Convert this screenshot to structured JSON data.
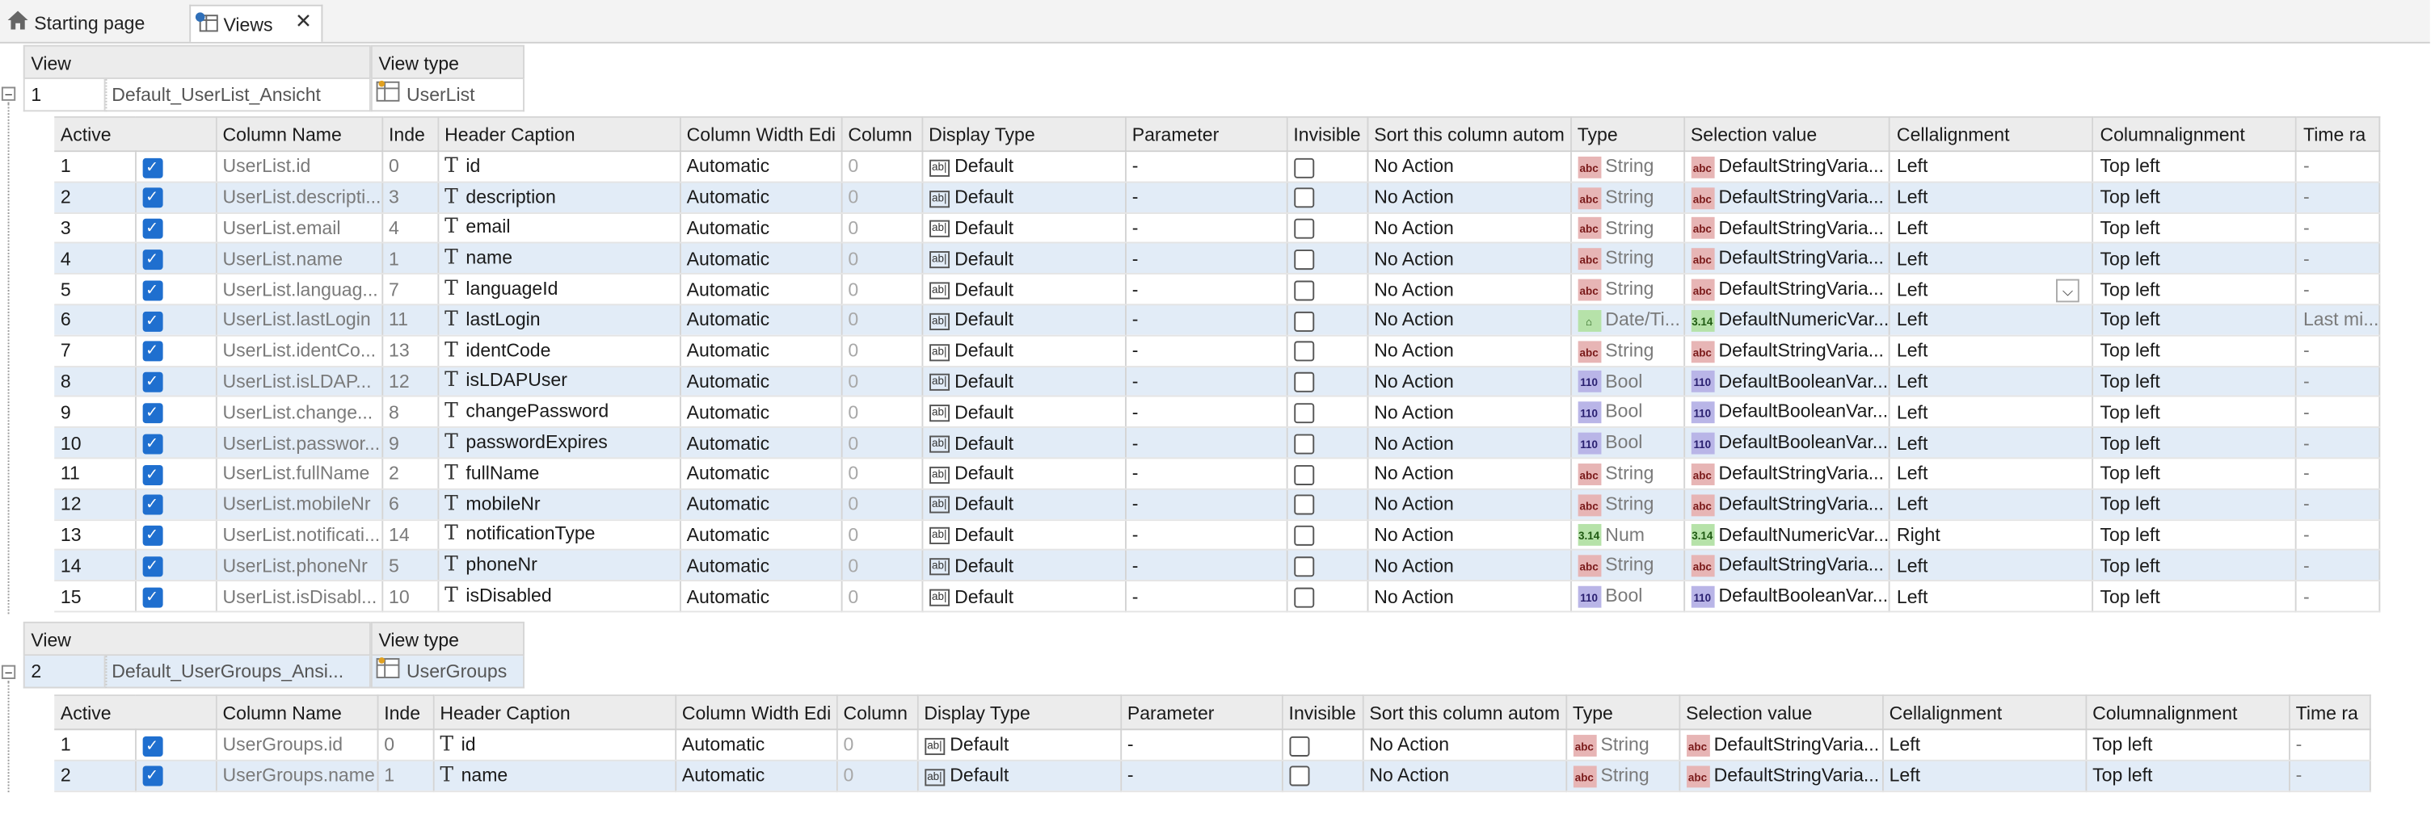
{
  "tabs": [
    {
      "label": "Starting page",
      "icon": "home-icon"
    },
    {
      "label": "Views",
      "icon": "views-icon",
      "close": "✕"
    }
  ],
  "view_labels": {
    "view": "View",
    "view_type": "View type"
  },
  "columns": [
    "Active",
    "Column Name",
    "Inde",
    "Header Caption",
    "Column Width Edi",
    "Column",
    "Display Type",
    "Parameter",
    "Invisible",
    "Sort this column autom",
    "Type",
    "Selection value",
    "Cellalignment",
    "Columnalignment",
    "Time ra"
  ],
  "views": [
    {
      "number": "1",
      "name": "Default_UserList_Ansicht",
      "type": "UserList",
      "rows": [
        {
          "n": "1",
          "name": "UserList.id",
          "idx": "0",
          "caption": "id",
          "width": "Automatic",
          "col": "0",
          "disp": "Default",
          "param": "-",
          "sort": "No Action",
          "type": "String",
          "tkind": "string",
          "sel": "DefaultStringVaria...",
          "skind": "string",
          "cell": "Left",
          "colal": "Top left",
          "time": "-"
        },
        {
          "n": "2",
          "name": "UserList.descripti...",
          "idx": "3",
          "caption": "description",
          "width": "Automatic",
          "col": "0",
          "disp": "Default",
          "param": "-",
          "sort": "No Action",
          "type": "String",
          "tkind": "string",
          "sel": "DefaultStringVaria...",
          "skind": "string",
          "cell": "Left",
          "colal": "Top left",
          "time": "-"
        },
        {
          "n": "3",
          "name": "UserList.email",
          "idx": "4",
          "caption": "email",
          "width": "Automatic",
          "col": "0",
          "disp": "Default",
          "param": "-",
          "sort": "No Action",
          "type": "String",
          "tkind": "string",
          "sel": "DefaultStringVaria...",
          "skind": "string",
          "cell": "Left",
          "colal": "Top left",
          "time": "-"
        },
        {
          "n": "4",
          "name": "UserList.name",
          "idx": "1",
          "caption": "name",
          "width": "Automatic",
          "col": "0",
          "disp": "Default",
          "param": "-",
          "sort": "No Action",
          "type": "String",
          "tkind": "string",
          "sel": "DefaultStringVaria...",
          "skind": "string",
          "cell": "Left",
          "colal": "Top left",
          "time": "-"
        },
        {
          "n": "5",
          "name": "UserList.languag...",
          "idx": "7",
          "caption": "languageId",
          "width": "Automatic",
          "col": "0",
          "disp": "Default",
          "param": "-",
          "sort": "No Action",
          "type": "String",
          "tkind": "string",
          "sel": "DefaultStringVaria...",
          "skind": "string",
          "cell": "Left",
          "colal": "Top left",
          "time": "-"
        },
        {
          "n": "6",
          "name": "UserList.lastLogin",
          "idx": "11",
          "caption": "lastLogin",
          "width": "Automatic",
          "col": "0",
          "disp": "Default",
          "param": "-",
          "sort": "No Action",
          "type": "Date/Ti...",
          "tkind": "date",
          "sel": "DefaultNumericVar...",
          "skind": "num",
          "cell": "Left",
          "colal": "Top left",
          "time": "Last mi..."
        },
        {
          "n": "7",
          "name": "UserList.identCo...",
          "idx": "13",
          "caption": "identCode",
          "width": "Automatic",
          "col": "0",
          "disp": "Default",
          "param": "-",
          "sort": "No Action",
          "type": "String",
          "tkind": "string",
          "sel": "DefaultStringVaria...",
          "skind": "string",
          "cell": "Left",
          "colal": "Top left",
          "time": "-"
        },
        {
          "n": "8",
          "name": "UserList.isLDAP...",
          "idx": "12",
          "caption": "isLDAPUser",
          "width": "Automatic",
          "col": "0",
          "disp": "Default",
          "param": "-",
          "sort": "No Action",
          "type": "Bool",
          "tkind": "bool",
          "sel": "DefaultBooleanVar...",
          "skind": "bool",
          "cell": "Left",
          "colal": "Top left",
          "time": "-"
        },
        {
          "n": "9",
          "name": "UserList.change...",
          "idx": "8",
          "caption": "changePassword",
          "width": "Automatic",
          "col": "0",
          "disp": "Default",
          "param": "-",
          "sort": "No Action",
          "type": "Bool",
          "tkind": "bool",
          "sel": "DefaultBooleanVar...",
          "skind": "bool",
          "cell": "Left",
          "colal": "Top left",
          "time": "-"
        },
        {
          "n": "10",
          "name": "UserList.passwor...",
          "idx": "9",
          "caption": "passwordExpires",
          "width": "Automatic",
          "col": "0",
          "disp": "Default",
          "param": "-",
          "sort": "No Action",
          "type": "Bool",
          "tkind": "bool",
          "sel": "DefaultBooleanVar...",
          "skind": "bool",
          "cell": "Left",
          "colal": "Top left",
          "time": "-"
        },
        {
          "n": "11",
          "name": "UserList.fullName",
          "idx": "2",
          "caption": "fullName",
          "width": "Automatic",
          "col": "0",
          "disp": "Default",
          "param": "-",
          "sort": "No Action",
          "type": "String",
          "tkind": "string",
          "sel": "DefaultStringVaria...",
          "skind": "string",
          "cell": "Left",
          "colal": "Top left",
          "time": "-"
        },
        {
          "n": "12",
          "name": "UserList.mobileNr",
          "idx": "6",
          "caption": "mobileNr",
          "width": "Automatic",
          "col": "0",
          "disp": "Default",
          "param": "-",
          "sort": "No Action",
          "type": "String",
          "tkind": "string",
          "sel": "DefaultStringVaria...",
          "skind": "string",
          "cell": "Left",
          "colal": "Top left",
          "time": "-"
        },
        {
          "n": "13",
          "name": "UserList.notificati...",
          "idx": "14",
          "caption": "notificationType",
          "width": "Automatic",
          "col": "0",
          "disp": "Default",
          "param": "-",
          "sort": "No Action",
          "type": "Num",
          "tkind": "num",
          "sel": "DefaultNumericVar...",
          "skind": "num",
          "cell": "Right",
          "colal": "Top left",
          "time": "-"
        },
        {
          "n": "14",
          "name": "UserList.phoneNr",
          "idx": "5",
          "caption": "phoneNr",
          "width": "Automatic",
          "col": "0",
          "disp": "Default",
          "param": "-",
          "sort": "No Action",
          "type": "String",
          "tkind": "string",
          "sel": "DefaultStringVaria...",
          "skind": "string",
          "cell": "Left",
          "colal": "Top left",
          "time": "-"
        },
        {
          "n": "15",
          "name": "UserList.isDisabl...",
          "idx": "10",
          "caption": "isDisabled",
          "width": "Automatic",
          "col": "0",
          "disp": "Default",
          "param": "-",
          "sort": "No Action",
          "type": "Bool",
          "tkind": "bool",
          "sel": "DefaultBooleanVar...",
          "skind": "bool",
          "cell": "Left",
          "colal": "Top left",
          "time": "-"
        }
      ]
    },
    {
      "number": "2",
      "name": "Default_UserGroups_Ansi...",
      "type": "UserGroups",
      "rows": [
        {
          "n": "1",
          "name": "UserGroups.id",
          "idx": "0",
          "caption": "id",
          "width": "Automatic",
          "col": "0",
          "disp": "Default",
          "param": "-",
          "sort": "No Action",
          "type": "String",
          "tkind": "string",
          "sel": "DefaultStringVaria...",
          "skind": "string",
          "cell": "Left",
          "colal": "Top left",
          "time": "-"
        },
        {
          "n": "2",
          "name": "UserGroups.name",
          "idx": "1",
          "caption": "name",
          "width": "Automatic",
          "col": "0",
          "disp": "Default",
          "param": "-",
          "sort": "No Action",
          "type": "String",
          "tkind": "string",
          "sel": "DefaultStringVaria...",
          "skind": "string",
          "cell": "Left",
          "colal": "Top left",
          "time": "-"
        }
      ]
    }
  ],
  "type_icons": {
    "string": "abc",
    "bool": "110",
    "num": "3.14",
    "date": "⌂"
  },
  "colors": {
    "selected_row": "#e2ecf7",
    "checkbox": "#1f6fcf",
    "header": "#ececec"
  }
}
